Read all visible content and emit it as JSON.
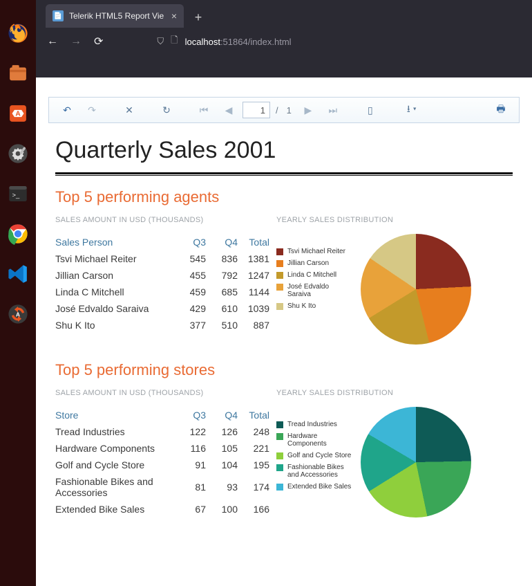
{
  "browser": {
    "tab_title": "Telerik HTML5 Report Vie",
    "url_host": "localhost",
    "url_port": ":51864",
    "url_path": "/index.html"
  },
  "toolbar": {
    "page_current": "1",
    "page_total": "1"
  },
  "report": {
    "title": "Quarterly Sales 2001",
    "agents": {
      "heading": "Top 5 performing agents",
      "subhead_left": "SALES AMOUNT IN USD (THOUSANDS)",
      "subhead_right": "YEARLY SALES DISTRIBUTION",
      "col_label": "Sales Person",
      "col_q3": "Q3",
      "col_q4": "Q4",
      "col_total": "Total",
      "rows": [
        {
          "name": "Tsvi Michael Reiter",
          "q3": "545",
          "q4": "836",
          "total": "1381"
        },
        {
          "name": "Jillian  Carson",
          "q3": "455",
          "q4": "792",
          "total": "1247"
        },
        {
          "name": "Linda C Mitchell",
          "q3": "459",
          "q4": "685",
          "total": "1144"
        },
        {
          "name": "José Edvaldo Saraiva",
          "q3": "429",
          "q4": "610",
          "total": "1039"
        },
        {
          "name": "Shu K Ito",
          "q3": "377",
          "q4": "510",
          "total": "887"
        }
      ]
    },
    "stores": {
      "heading": "Top 5 performing stores",
      "subhead_left": "SALES AMOUNT IN USD (THOUSANDS)",
      "subhead_right": "YEARLY SALES DISTRIBUTION",
      "col_label": "Store",
      "col_q3": "Q3",
      "col_q4": "Q4",
      "col_total": "Total",
      "rows": [
        {
          "name": "Tread Industries",
          "q3": "122",
          "q4": "126",
          "total": "248"
        },
        {
          "name": "Hardware Components",
          "q3": "116",
          "q4": "105",
          "total": "221"
        },
        {
          "name": "Golf and Cycle Store",
          "q3": "91",
          "q4": "104",
          "total": "195"
        },
        {
          "name": "Fashionable Bikes and Accessories",
          "q3": "81",
          "q4": "93",
          "total": "174"
        },
        {
          "name": "Extended Bike Sales",
          "q3": "67",
          "q4": "100",
          "total": "166"
        }
      ]
    }
  },
  "chart_data": [
    {
      "type": "pie",
      "title": "YEARLY SALES DISTRIBUTION",
      "series_name": "Top 5 performing agents",
      "categories": [
        "Tsvi Michael Reiter",
        "Jillian  Carson",
        "Linda C Mitchell",
        "José Edvaldo Saraiva",
        "Shu K Ito"
      ],
      "values": [
        1381,
        1247,
        1144,
        1039,
        887
      ],
      "colors": [
        "#8a2b1f",
        "#e77e1e",
        "#c39a2b",
        "#e8a23a",
        "#d6c885"
      ]
    },
    {
      "type": "pie",
      "title": "YEARLY SALES DISTRIBUTION",
      "series_name": "Top 5 performing stores",
      "categories": [
        "Tread Industries",
        "Hardware Components",
        "Golf and Cycle Store",
        "Fashionable Bikes and Accessories",
        "Extended Bike Sales"
      ],
      "values": [
        248,
        221,
        195,
        174,
        166
      ],
      "colors": [
        "#0e5b56",
        "#3aa657",
        "#8fcf3c",
        "#1fa58a",
        "#3cb6d6"
      ]
    }
  ]
}
